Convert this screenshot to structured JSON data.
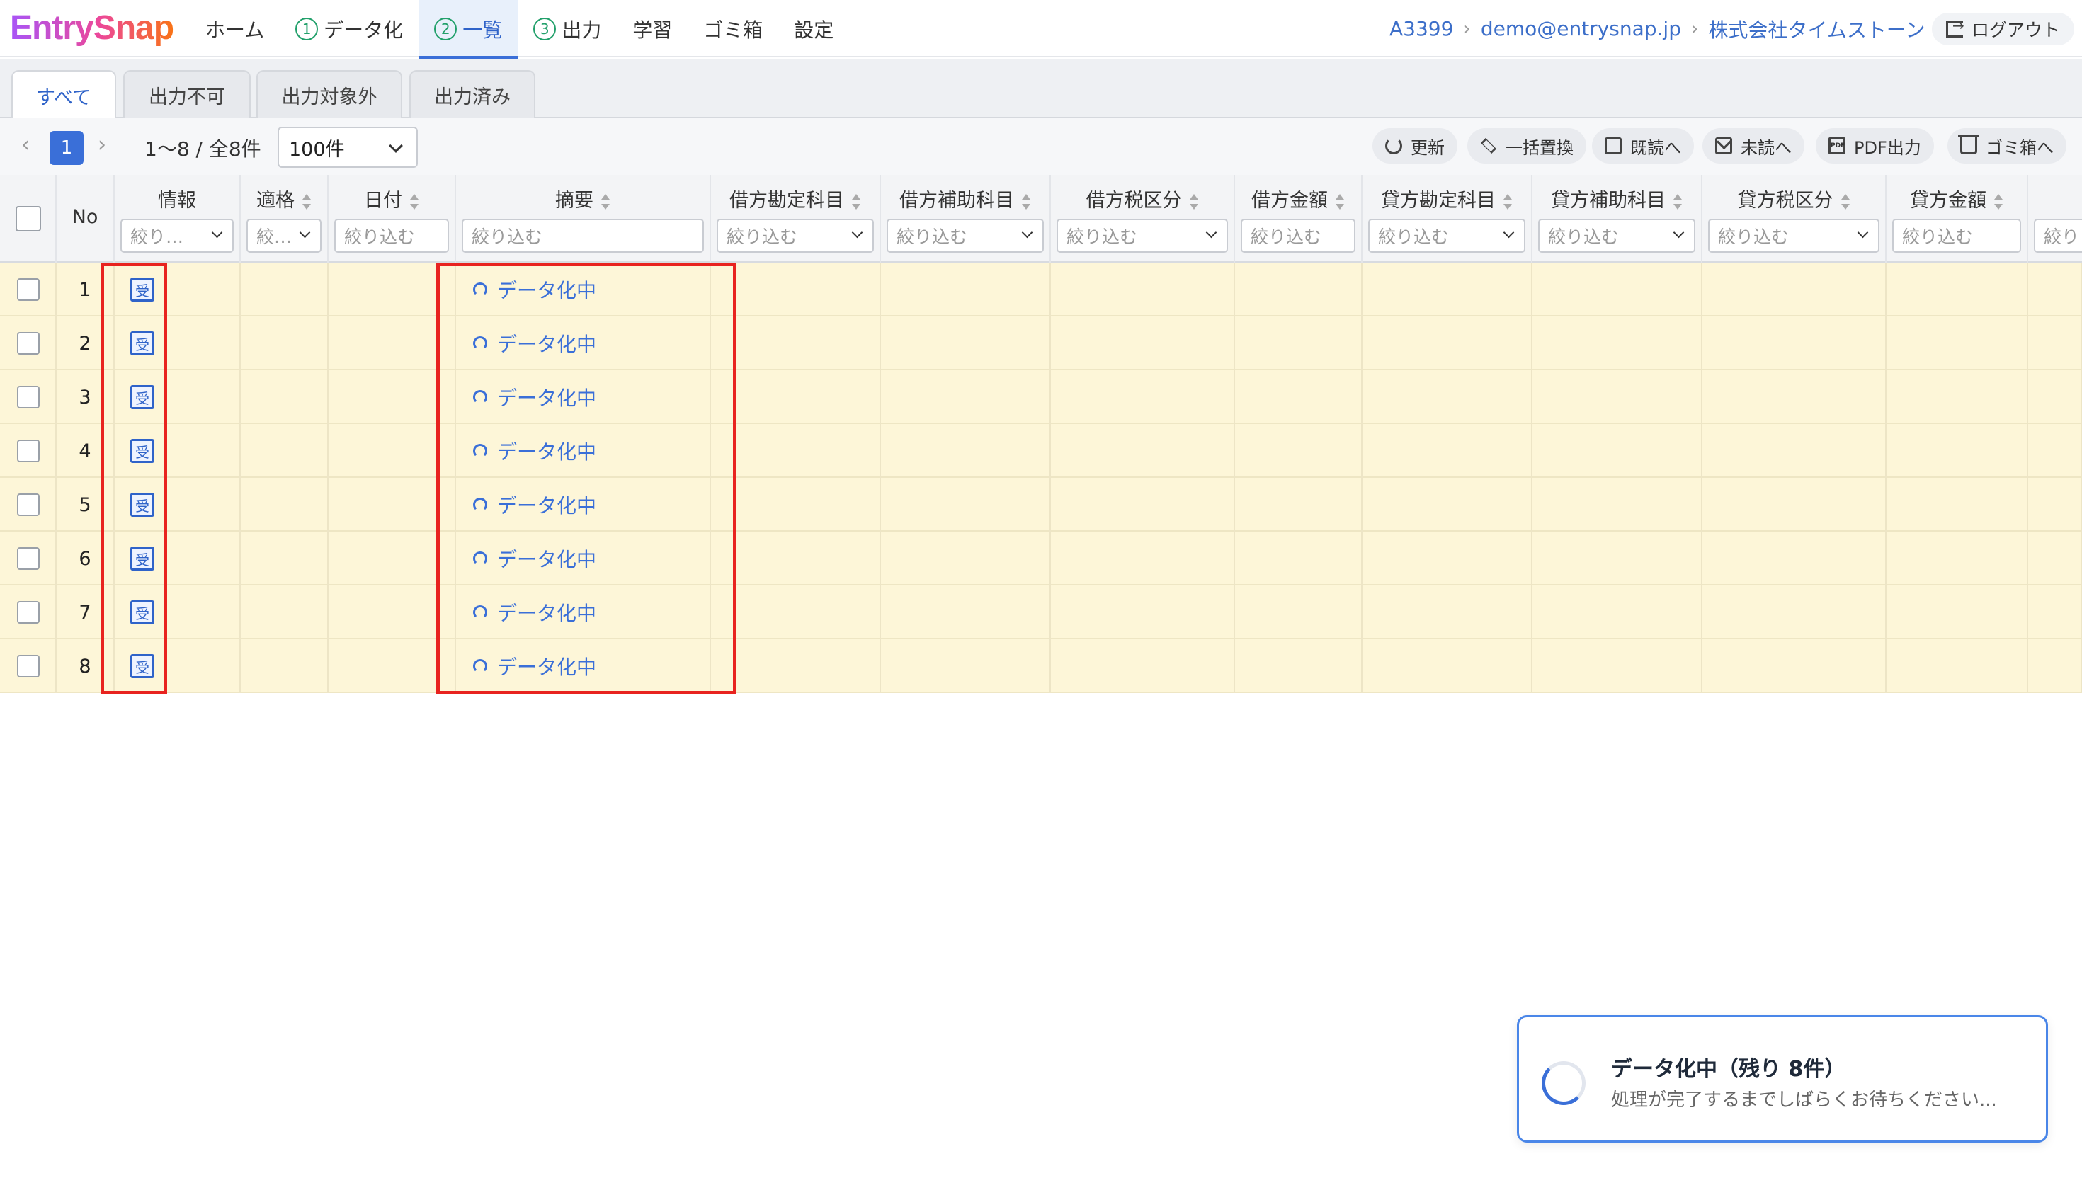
{
  "app": {
    "logo": "EntrySnap"
  },
  "nav": {
    "items": [
      {
        "label": "ホーム",
        "step": ""
      },
      {
        "label": "データ化",
        "step": "1"
      },
      {
        "label": "一覧",
        "step": "2"
      },
      {
        "label": "出力",
        "step": "3"
      },
      {
        "label": "学習",
        "step": ""
      },
      {
        "label": "ゴミ箱",
        "step": ""
      },
      {
        "label": "設定",
        "step": ""
      }
    ],
    "active": "一覧"
  },
  "breadcrumb": {
    "account": "A3399",
    "email": "demo@entrysnap.jp",
    "company": "株式会社タイムストーン",
    "separator": "›"
  },
  "logout_label": "ログアウト",
  "tabs": [
    "すべて",
    "出力不可",
    "出力対象外",
    "出力済み"
  ],
  "active_tab": "すべて",
  "pagination": {
    "prev": "‹",
    "next": "›",
    "current": "1",
    "info": "1〜8 / 全8件",
    "page_size": "100件"
  },
  "toolbar": {
    "refresh": "更新",
    "bulk_replace": "一括置換",
    "mark_read": "既読へ",
    "mark_unread": "未読へ",
    "pdf_export": "PDF出力",
    "to_trash": "ゴミ箱へ"
  },
  "columns": {
    "no": "No",
    "info": "情報",
    "invoice": "適格",
    "date": "日付",
    "summary": "摘要",
    "debit_account": "借方勘定科目",
    "debit_sub": "借方補助科目",
    "debit_tax": "借方税区分",
    "debit_amount": "借方金額",
    "credit_account": "貸方勘定科目",
    "credit_sub": "貸方補助科目",
    "credit_tax": "貸方税区分",
    "credit_amount": "貸方金額"
  },
  "filters": {
    "info": "絞り…",
    "invoice": "絞…",
    "date": "絞り込む",
    "summary": "絞り込む",
    "debit_account": "絞り込む",
    "debit_sub": "絞り込む",
    "debit_tax": "絞り込む",
    "debit_amount": "絞り込む",
    "credit_account": "絞り込む",
    "credit_sub": "絞り込む",
    "credit_tax": "絞り込む",
    "credit_amount": "絞り込む",
    "extra": "絞り"
  },
  "rows": [
    {
      "no": "1",
      "badge": "受",
      "status": "データ化中"
    },
    {
      "no": "2",
      "badge": "受",
      "status": "データ化中"
    },
    {
      "no": "3",
      "badge": "受",
      "status": "データ化中"
    },
    {
      "no": "4",
      "badge": "受",
      "status": "データ化中"
    },
    {
      "no": "5",
      "badge": "受",
      "status": "データ化中"
    },
    {
      "no": "6",
      "badge": "受",
      "status": "データ化中"
    },
    {
      "no": "7",
      "badge": "受",
      "status": "データ化中"
    },
    {
      "no": "8",
      "badge": "受",
      "status": "データ化中"
    }
  ],
  "toast": {
    "title": "データ化中（残り 8件）",
    "message": "処理が完了するまでしばらくお待ちください..."
  },
  "colors": {
    "accent": "#3a6fd8",
    "row_highlight": "#fdf6d8",
    "annotation": "#e8231f",
    "step_green": "#22a06b"
  }
}
